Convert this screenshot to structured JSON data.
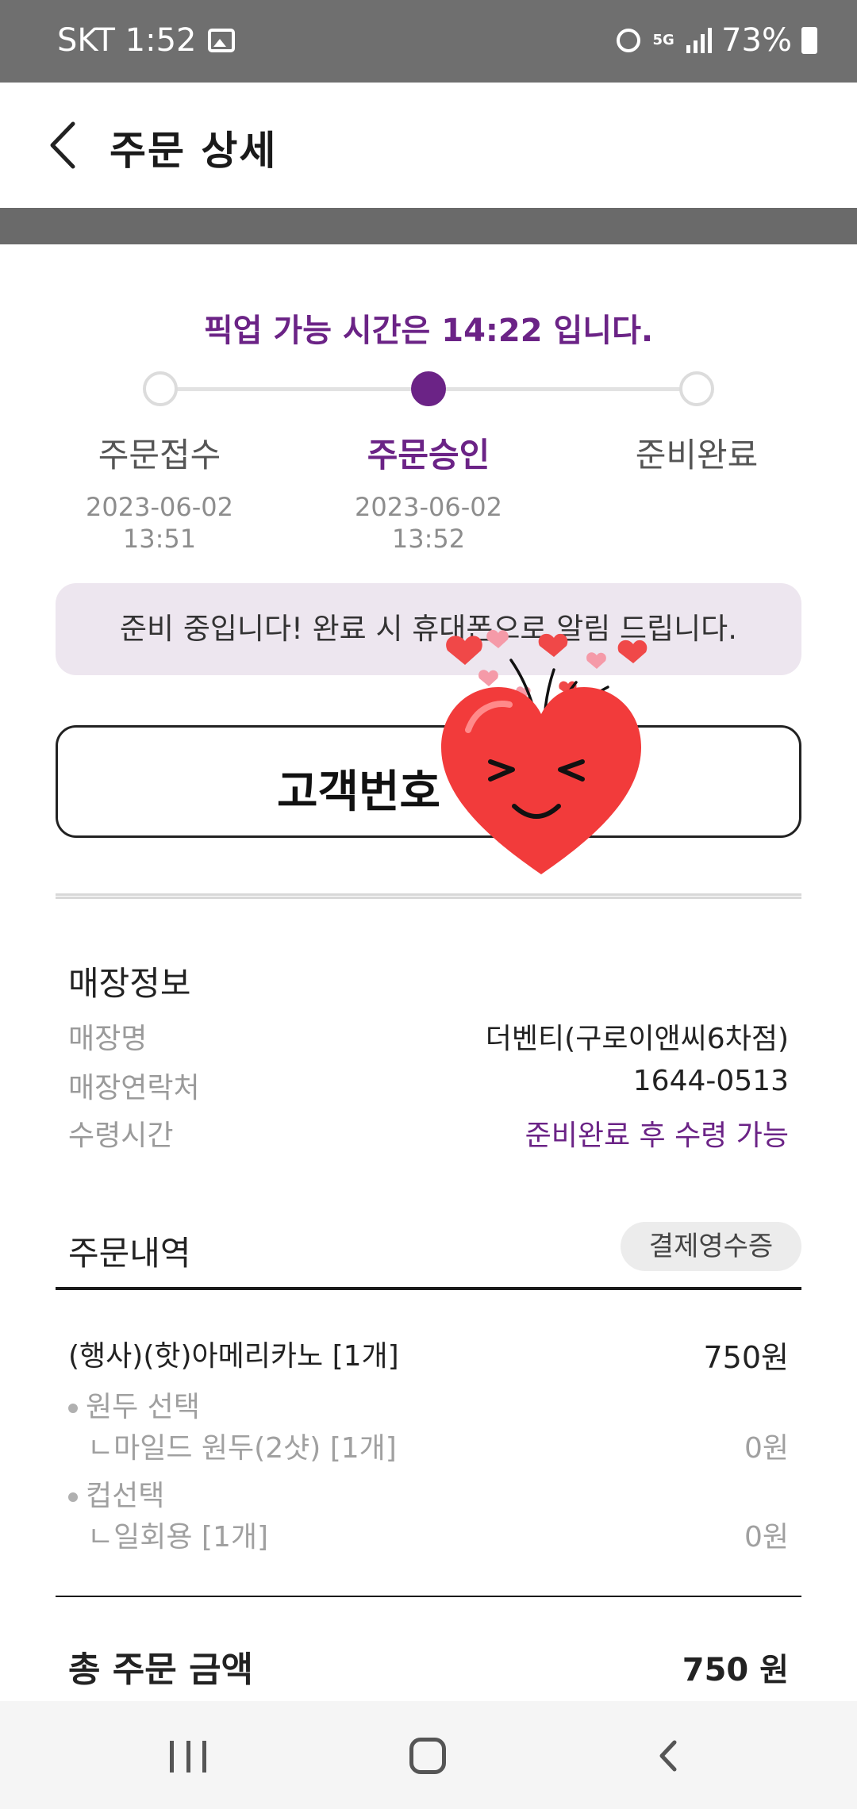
{
  "status_bar": {
    "carrier_time": "SKT 1:52",
    "network": "5G",
    "battery": "73%"
  },
  "header": {
    "title": "주문 상세"
  },
  "pickup": {
    "message": "픽업 가능 시간은 14:22 입니다."
  },
  "progress": {
    "steps": [
      {
        "label": "주문접수",
        "date": "2023-06-02",
        "time": "13:51",
        "active": false
      },
      {
        "label": "주문승인",
        "date": "2023-06-02",
        "time": "13:52",
        "active": true
      },
      {
        "label": "준비완료",
        "date": "",
        "time": "",
        "active": false
      }
    ]
  },
  "notice": {
    "text": "준비 중입니다! 완료 시 휴대폰으로 알림 드립니다."
  },
  "customer": {
    "label": "고객번호"
  },
  "store": {
    "title": "매장정보",
    "rows": [
      {
        "key": "매장명",
        "value": "더벤티(구로이앤씨6차점)"
      },
      {
        "key": "매장연락처",
        "value": "1644-0513"
      },
      {
        "key": "수령시간",
        "value": "준비완료 후 수령 가능"
      }
    ]
  },
  "order": {
    "title": "주문내역",
    "receipt_button": "결제영수증",
    "item": {
      "name": "(행사)(핫)아메리카노 [1개]",
      "price": "750원"
    },
    "options": [
      {
        "group": "원두 선택",
        "choice": "ㄴ마일드 원두(2샷) [1개]",
        "price": "0원"
      },
      {
        "group": "컵선택",
        "choice": "ㄴ일회용 [1개]",
        "price": "0원"
      }
    ],
    "total_label": "총 주문 금액",
    "total_value": "750 원"
  },
  "colors": {
    "accent": "#6b2386",
    "notice_bg": "#ede6ef",
    "status_bar": "#6f6f6f"
  },
  "icons": [
    "image-icon",
    "alarm-icon",
    "signal-icon",
    "battery-icon",
    "back-arrow-icon",
    "heart-sticker",
    "nav-recent-icon",
    "nav-home-icon",
    "nav-back-icon"
  ]
}
